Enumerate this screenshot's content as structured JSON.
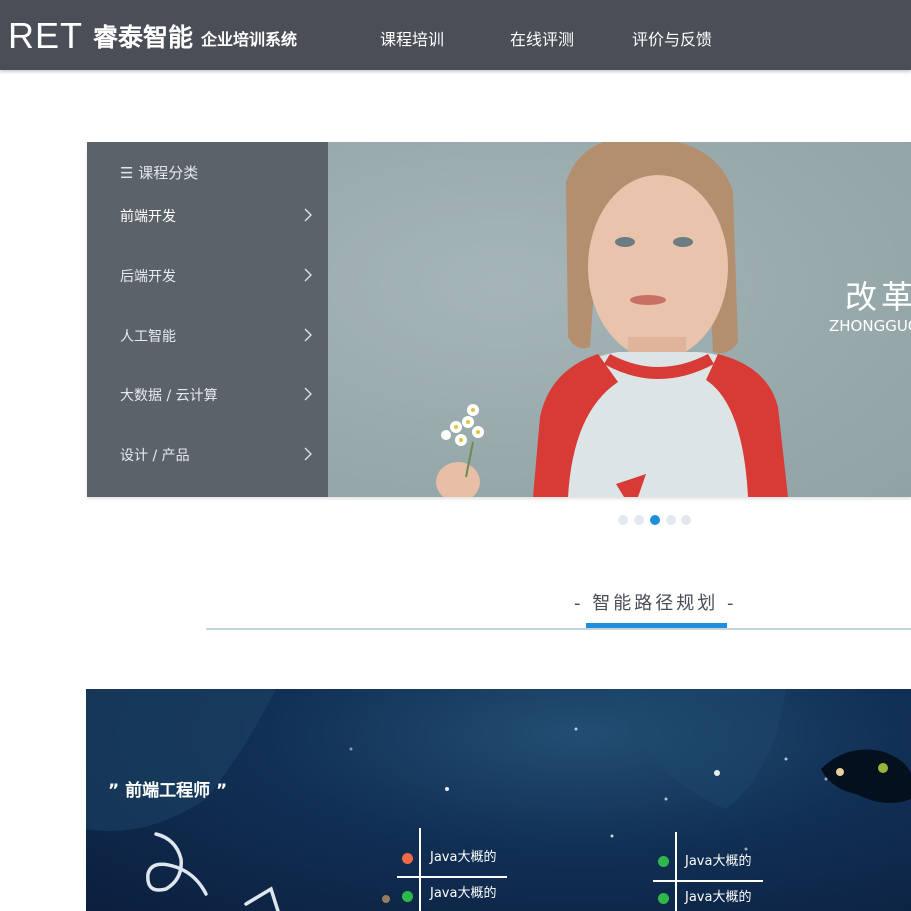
{
  "header": {
    "logo_ret": "RET",
    "logo_cn": "睿泰智能",
    "logo_sub": "企业培训系统",
    "nav": [
      "课程培训",
      "在线评测",
      "评价与反馈"
    ]
  },
  "sidebar": {
    "header_icon": "☰",
    "header_label": "课程分类",
    "items": [
      {
        "label": "前端开发",
        "active": true
      },
      {
        "label": "后端开发",
        "active": false
      },
      {
        "label": "人工智能",
        "active": false
      },
      {
        "label": "大数据 / 云计算",
        "active": false
      },
      {
        "label": "设计 / 产品",
        "active": false
      }
    ]
  },
  "banner": {
    "title": "改革",
    "subtitle": "ZHONGGUO"
  },
  "carousel": {
    "count": 5,
    "active_index": 2
  },
  "section": {
    "title": "- 智能路径规划 -"
  },
  "path": {
    "title": "” 前端工程师 ”",
    "nodes": [
      {
        "label": "Java大概的",
        "dot_color": "#f2684a"
      },
      {
        "label": "Java大概的",
        "dot_color": "#2fb84a"
      },
      {
        "label": "Java大概的",
        "dot_color": "#2fb84a"
      },
      {
        "label": "Java大概的",
        "dot_color": "#2fb84a"
      }
    ]
  },
  "colors": {
    "header_bg": "#4a4e56",
    "accent_blue": "#1f8fdd",
    "sidebar_bg": "#545c64",
    "dark_bg": "#113055"
  }
}
